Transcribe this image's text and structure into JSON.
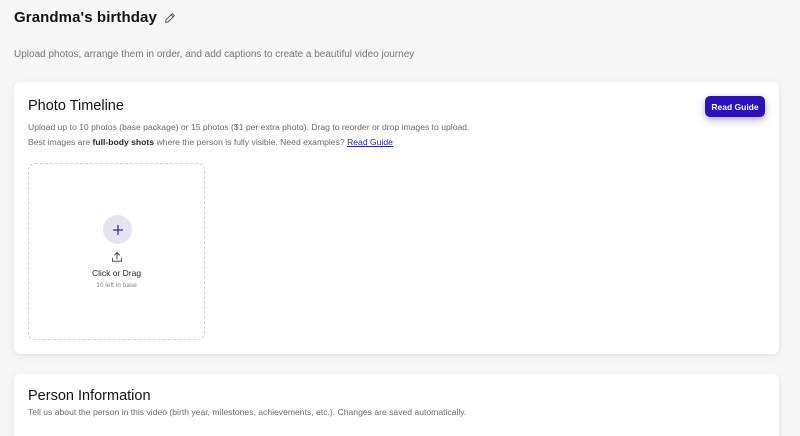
{
  "header": {
    "title": "Grandma's birthday",
    "subtitle": "Upload photos, arrange them in order, and add captions to create a beautiful video journey"
  },
  "timeline": {
    "title": "Photo Timeline",
    "description": "Upload up to 10 photos (base package) or 15 photos ($1 per extra photo). Drag to reorder or drop images to upload.",
    "tip_prefix": "Best images are ",
    "tip_bold": "full-body shots",
    "tip_suffix": " where the person is fully visible. Need examples? ",
    "tip_link": "Read Guide",
    "read_guide_button": "Read Guide",
    "upload": {
      "label": "Click or Drag",
      "remaining": "10 left in base"
    }
  },
  "person": {
    "title": "Person Information",
    "description": "Tell us about the person in this video (birth year, milestones, achievements, etc.). Changes are saved automatically."
  },
  "colors": {
    "accent": "#2c10b8",
    "plus_circle_bg": "#e6e3f3",
    "link": "#2b2b8f"
  },
  "icons": {
    "edit": "pencil-icon",
    "add": "plus-icon",
    "upload": "upload-icon"
  }
}
